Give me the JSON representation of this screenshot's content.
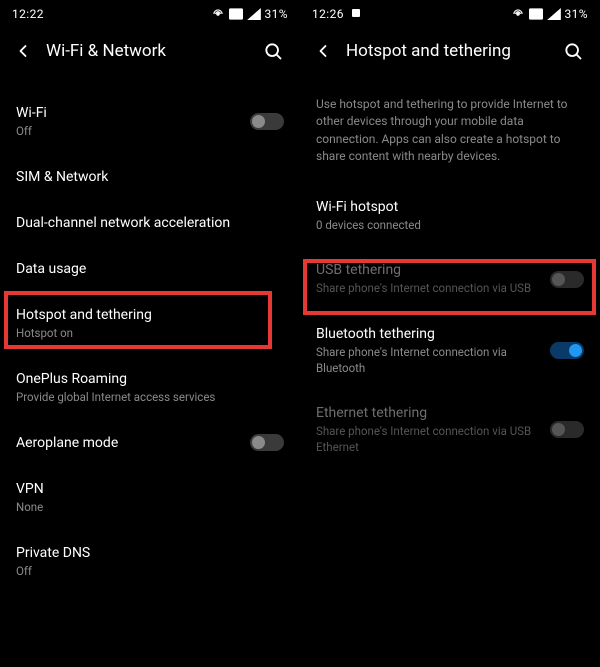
{
  "left": {
    "status": {
      "time": "12:22",
      "battery": "31%"
    },
    "header": "Wi-Fi & Network",
    "items": [
      {
        "title": "Wi-Fi",
        "sub": "Off",
        "toggle": "off"
      },
      {
        "title": "SIM & Network"
      },
      {
        "title": "Dual-channel network acceleration"
      },
      {
        "title": "Data usage"
      },
      {
        "title": "Hotspot and tethering",
        "sub": "Hotspot on"
      },
      {
        "title": "OnePlus Roaming",
        "sub": "Provide global Internet access services"
      },
      {
        "title": "Aeroplane mode",
        "toggle": "off"
      },
      {
        "title": "VPN",
        "sub": "None"
      },
      {
        "title": "Private DNS",
        "sub": "Off"
      }
    ]
  },
  "right": {
    "status": {
      "time": "12:26",
      "battery": "31%"
    },
    "header": "Hotspot and tethering",
    "description": "Use hotspot and tethering to provide Internet to other devices through your mobile data connection. Apps can also create a hotspot to share content with nearby devices.",
    "items": [
      {
        "title": "Wi-Fi hotspot",
        "sub": "0 devices connected"
      },
      {
        "title": "USB tethering",
        "sub": "Share phone's Internet connection via USB",
        "toggle": "off-dim",
        "disabled": true
      },
      {
        "title": "Bluetooth tethering",
        "sub": "Share phone's Internet connection via Bluetooth",
        "toggle": "on"
      },
      {
        "title": "Ethernet tethering",
        "sub": "Share phone's Internet connection via USB Ethernet",
        "toggle": "off-dim",
        "disabled": true
      }
    ]
  }
}
